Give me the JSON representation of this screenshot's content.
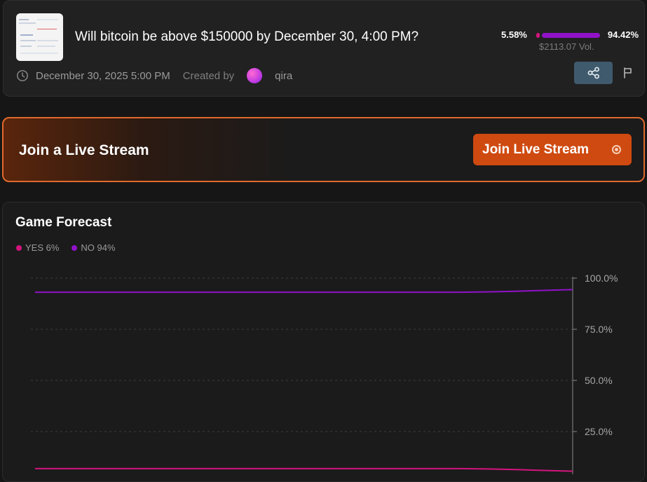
{
  "market": {
    "title": "Will bitcoin be above $150000 by December 30, 4:00 PM?",
    "date": "December 30, 2025 5:00 PM",
    "created_by_label": "Created by",
    "creator": "qira",
    "yes_pct": "5.58%",
    "no_pct": "94.42%",
    "yes_share": 0.0558,
    "no_share": 0.9442,
    "volume": "$2113.07 Vol.",
    "icons": {
      "clock": "clock-icon",
      "share": "share-icon",
      "flag": "flag-icon"
    }
  },
  "live_stream": {
    "label": "Join a Live Stream",
    "button_label": "Join Live Stream",
    "accent": "#cf4a10"
  },
  "forecast": {
    "title": "Game Forecast",
    "legend": [
      {
        "label": "YES 6%",
        "color": "#d4147e"
      },
      {
        "label": "NO 94%",
        "color": "#9112c9"
      }
    ]
  },
  "chart_data": {
    "type": "line",
    "title": "Game Forecast",
    "yticks": [
      "100.0%",
      "75.0%",
      "50.0%",
      "25.0%"
    ],
    "ylim": [
      0,
      100
    ],
    "grid": true,
    "series": [
      {
        "name": "YES 6%",
        "color": "#d4147e",
        "values": [
          6.9,
          6.9,
          6.9,
          6.9,
          6.9,
          6.9,
          6.9,
          6.9,
          6.9,
          6.9,
          6.9,
          6.9,
          6.9,
          6.9,
          6.9,
          6.9,
          6.7,
          6.4,
          6.0,
          5.6
        ]
      },
      {
        "name": "NO 94%",
        "color": "#9112c9",
        "values": [
          93.1,
          93.1,
          93.1,
          93.1,
          93.1,
          93.1,
          93.1,
          93.1,
          93.1,
          93.1,
          93.1,
          93.1,
          93.1,
          93.1,
          93.1,
          93.1,
          93.3,
          93.6,
          94.0,
          94.4
        ]
      }
    ]
  }
}
